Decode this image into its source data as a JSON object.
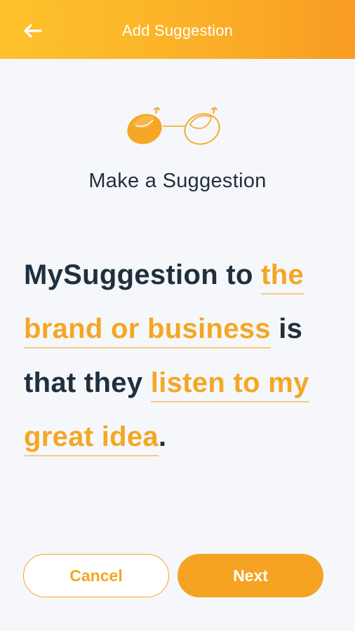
{
  "header": {
    "title": "Add Suggestion",
    "back_icon": "arrow-left-icon"
  },
  "steps": {
    "icons": [
      "acorn-filled-icon",
      "acorn-outline-icon"
    ],
    "active_step": 1,
    "total_steps": 2
  },
  "section": {
    "title": "Make a Suggestion"
  },
  "sentence": {
    "part1": "MySuggestion to ",
    "blank1": "the brand or business",
    "part2": " is that they ",
    "blank2": "listen to my great idea",
    "part3": "."
  },
  "actions": {
    "cancel_label": "Cancel",
    "next_label": "Next"
  },
  "colors": {
    "accent": "#f5a623",
    "header_start": "#fdc22b",
    "header_end": "#f89b22",
    "text_dark": "#1f2f3d",
    "background": "#f5f7fa"
  }
}
